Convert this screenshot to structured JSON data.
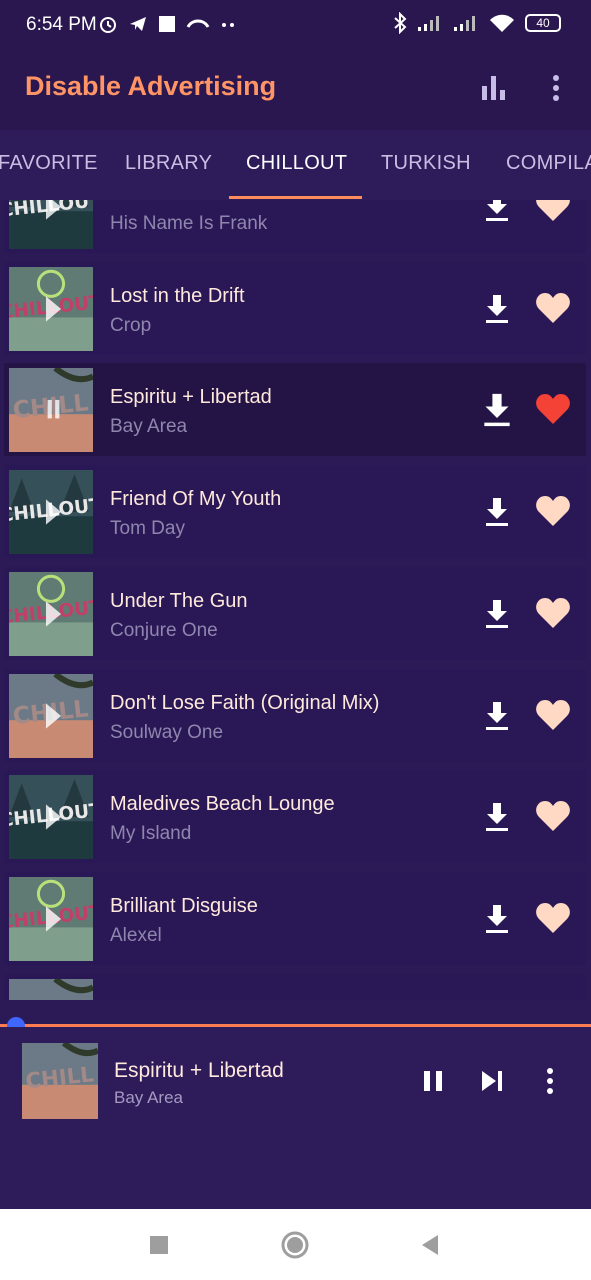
{
  "status_bar": {
    "time": "6:54 PM",
    "battery": "40"
  },
  "app_bar": {
    "title": "Disable Advertising",
    "title_color": "#ff9566",
    "icons": [
      "bar-chart-icon",
      "more-vert-icon"
    ]
  },
  "tabs": [
    {
      "label": "FAVORITE",
      "active": false
    },
    {
      "label": "LIBRARY",
      "active": false
    },
    {
      "label": "CHILLOUT",
      "active": true
    },
    {
      "label": "TURKISH",
      "active": false
    },
    {
      "label": "COMPILA",
      "active": false
    }
  ],
  "tracks": [
    {
      "title": "",
      "artist": "His Name Is Frank",
      "favorite": true,
      "playing": false,
      "art": "chillout-forest"
    },
    {
      "title": "Lost in the Drift",
      "artist": "Crop",
      "favorite": true,
      "playing": false,
      "art": "chillout-peace"
    },
    {
      "title": "Espiritu + Libertad",
      "artist": "Bay Area",
      "favorite": true,
      "playing": true,
      "art": "chill-beach"
    },
    {
      "title": "Friend Of My Youth",
      "artist": "Tom Day",
      "favorite": true,
      "playing": false,
      "art": "chillout-forest"
    },
    {
      "title": "Under The Gun",
      "artist": "Conjure One",
      "favorite": true,
      "playing": false,
      "art": "chillout-peace"
    },
    {
      "title": "Don't Lose Faith (Original Mix)",
      "artist": "Soulway One",
      "favorite": true,
      "playing": false,
      "art": "chill-beach"
    },
    {
      "title": "Maledives Beach Lounge",
      "artist": "My Island",
      "favorite": true,
      "playing": false,
      "art": "chillout-forest"
    },
    {
      "title": "Brilliant Disguise",
      "artist": "Alexel",
      "favorite": true,
      "playing": false,
      "art": "chillout-peace"
    },
    {
      "title": "",
      "artist": "",
      "favorite": true,
      "playing": false,
      "art": "chill-beach"
    }
  ],
  "colors": {
    "favorite_active": "#f44336",
    "favorite_inactive": "#ffd9c4",
    "progress": "#ff7b52",
    "progress_knob": "#3f67ff"
  },
  "now_playing": {
    "title": "Espiritu + Libertad",
    "artist": "Bay Area",
    "progress": 0.0,
    "state": "playing"
  },
  "thumb_labels": {
    "chillout": "CHILLOUT",
    "chill": "CHILL"
  }
}
